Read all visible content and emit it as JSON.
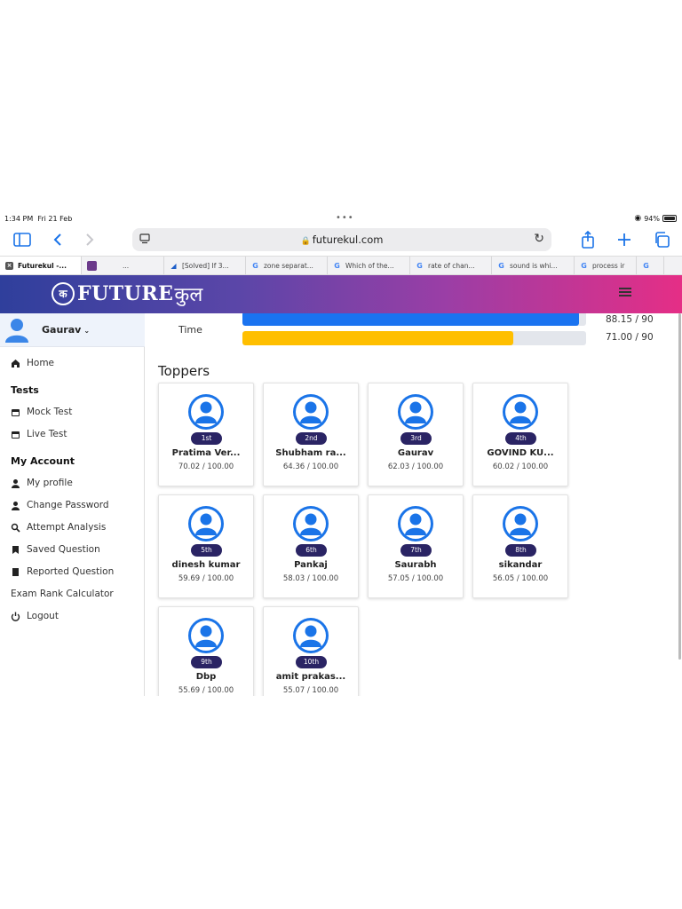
{
  "status": {
    "time": "1:34 PM",
    "date": "Fri 21 Feb",
    "battery": "94%"
  },
  "browser": {
    "url": "futurekul.com",
    "tabs": [
      {
        "label": "Futurekul -...",
        "icon": "close-x-icon",
        "active": true
      },
      {
        "label": "...",
        "icon": "app-icon",
        "active": false
      },
      {
        "label": "[Solved] If 3...",
        "icon": "doc-icon",
        "active": false
      },
      {
        "label": "zone separat...",
        "icon": "google-icon",
        "active": false
      },
      {
        "label": "Which of the...",
        "icon": "google-icon",
        "active": false
      },
      {
        "label": "rate of chan...",
        "icon": "google-icon",
        "active": false
      },
      {
        "label": "sound is whi...",
        "icon": "google-icon",
        "active": false
      },
      {
        "label": "process ir",
        "icon": "google-icon",
        "active": false
      },
      {
        "label": "",
        "icon": "google-icon",
        "active": false
      }
    ]
  },
  "header": {
    "logo_text": "FUTURE",
    "logo_hindi": "कुल"
  },
  "sidebar": {
    "user": "Gaurav",
    "tests_heading": "Tests",
    "account_heading": "My Account",
    "items": {
      "home": "Home",
      "mock": "Mock Test",
      "live": "Live Test",
      "profile": "My profile",
      "password": "Change Password",
      "attempt": "Attempt Analysis",
      "saved": "Saved Question",
      "reported": "Reported Question",
      "rank": "Exam Rank Calculator",
      "logout": "Logout"
    }
  },
  "main": {
    "time_label": "Time",
    "bars": [
      {
        "value": "88.15 / 90",
        "fraction": 0.9794,
        "color": "#1a73f0"
      },
      {
        "value": "71.00 / 90",
        "fraction": 0.7889,
        "color": "#ffbf00"
      }
    ],
    "toppers_title": "Toppers",
    "toppers": [
      {
        "rank": "1st",
        "name": "Pratima Ver...",
        "score": "70.02 / 100.00"
      },
      {
        "rank": "2nd",
        "name": "Shubham ra...",
        "score": "64.36 / 100.00"
      },
      {
        "rank": "3rd",
        "name": "Gaurav",
        "score": "62.03 / 100.00"
      },
      {
        "rank": "4th",
        "name": "GOVIND KU...",
        "score": "60.02 / 100.00"
      },
      {
        "rank": "5th",
        "name": "dinesh kumar",
        "score": "59.69 / 100.00"
      },
      {
        "rank": "6th",
        "name": "Pankaj",
        "score": "58.03 / 100.00"
      },
      {
        "rank": "7th",
        "name": "Saurabh",
        "score": "57.05 / 100.00"
      },
      {
        "rank": "8th",
        "name": "sikandar",
        "score": "56.05 / 100.00"
      },
      {
        "rank": "9th",
        "name": "Dbp",
        "score": "55.69 / 100.00"
      },
      {
        "rank": "10th",
        "name": "amit prakas...",
        "score": "55.07 / 100.00"
      }
    ]
  }
}
